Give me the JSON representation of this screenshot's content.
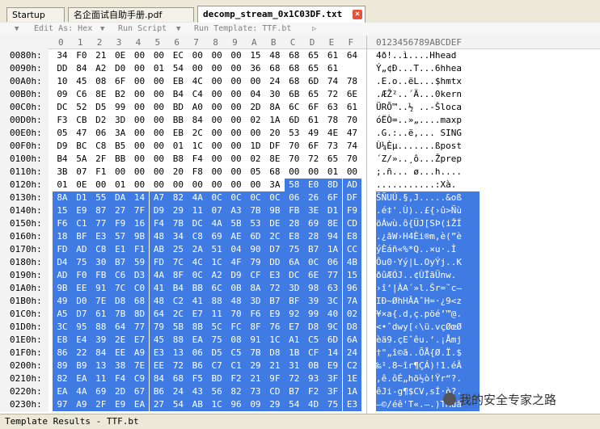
{
  "tabs": [
    {
      "label": "Startup"
    },
    {
      "label": "名企面试自助手册.pdf"
    },
    {
      "label": "decomp_stream_0x1C03DF.txt"
    }
  ],
  "toolbar": {
    "edit_as": "Edit As: Hex",
    "run_script": "Run Script",
    "run_template": "Run Template: TTF.bt"
  },
  "column_headers": [
    "0",
    "1",
    "2",
    "3",
    "4",
    "5",
    "6",
    "7",
    "8",
    "9",
    "A",
    "B",
    "C",
    "D",
    "E",
    "F"
  ],
  "ascii_header": "0123456789ABCDEF",
  "rows": [
    {
      "addr": "0080h:",
      "hex": [
        "34",
        "F0",
        "21",
        "0E",
        "00",
        "00",
        "EC",
        "00",
        "00",
        "00",
        "15",
        "48",
        "68",
        "65",
        "61",
        "64"
      ],
      "ascii": "4ð!..ì....Hhead"
    },
    {
      "addr": "0090h:",
      "hex": [
        "DD",
        "84",
        "A2",
        "D0",
        "00",
        "01",
        "54",
        "00",
        "00",
        "00",
        "36",
        "68",
        "68",
        "65",
        "61"
      ],
      "ascii": "Ý„¢Ð...T...6hhea"
    },
    {
      "addr": "00A0h:",
      "hex": [
        "10",
        "45",
        "08",
        "6F",
        "00",
        "00",
        "EB",
        "4C",
        "00",
        "00",
        "00",
        "24",
        "68",
        "6D",
        "74",
        "78"
      ],
      "ascii": ".E.o..ëL...$hmtx"
    },
    {
      "addr": "00B0h:",
      "hex": [
        "09",
        "C6",
        "8E",
        "B2",
        "00",
        "00",
        "B4",
        "C4",
        "00",
        "00",
        "04",
        "30",
        "6B",
        "65",
        "72",
        "6E"
      ],
      "ascii": ".ÆŽ²..´Ä...0kern"
    },
    {
      "addr": "00C0h:",
      "hex": [
        "DC",
        "52",
        "D5",
        "99",
        "00",
        "00",
        "BD",
        "A0",
        "00",
        "00",
        "2D",
        "8A",
        "6C",
        "6F",
        "63",
        "61"
      ],
      "ascii": "ÜRÕ™..½ ..-Šloca"
    },
    {
      "addr": "00D0h:",
      "hex": [
        "F3",
        "CB",
        "D2",
        "3D",
        "00",
        "00",
        "BB",
        "84",
        "00",
        "00",
        "02",
        "1A",
        "6D",
        "61",
        "78",
        "70"
      ],
      "ascii": "óËÒ=..»„....maxp"
    },
    {
      "addr": "00E0h:",
      "hex": [
        "05",
        "47",
        "06",
        "3A",
        "00",
        "00",
        "EB",
        "2C",
        "00",
        "00",
        "00",
        "20",
        "53",
        "49",
        "4E",
        "47"
      ],
      "ascii": ".G.:..ë,... SING"
    },
    {
      "addr": "00F0h:",
      "hex": [
        "D9",
        "BC",
        "C8",
        "B5",
        "00",
        "00",
        "01",
        "1C",
        "00",
        "00",
        "1D",
        "DF",
        "70",
        "6F",
        "73",
        "74"
      ],
      "ascii": "Ù¼Èµ.......ßpost"
    },
    {
      "addr": "0100h:",
      "hex": [
        "B4",
        "5A",
        "2F",
        "BB",
        "00",
        "00",
        "B8",
        "F4",
        "00",
        "00",
        "02",
        "8E",
        "70",
        "72",
        "65",
        "70"
      ],
      "ascii": "´Z/»..¸ô...Žprep"
    },
    {
      "addr": "0110h:",
      "hex": [
        "3B",
        "07",
        "F1",
        "00",
        "00",
        "00",
        "20",
        "F8",
        "00",
        "00",
        "05",
        "68",
        "00",
        "00",
        "01",
        "00"
      ],
      "ascii": ";.ñ... ø...h...."
    },
    {
      "addr": "0120h:",
      "hex": [
        "01",
        "0E",
        "00",
        "01",
        "00",
        "00",
        "00",
        "00",
        "00",
        "00",
        "00",
        "3A",
        "58",
        "E0",
        "8D",
        "AD"
      ],
      "ascii": "...........:Xà.­"
    },
    {
      "addr": "0130h:",
      "hex": [
        "8A",
        "D1",
        "55",
        "DA",
        "14",
        "A7",
        "82",
        "4A",
        "0C",
        "0C",
        "0C",
        "0C",
        "06",
        "26",
        "6F",
        "DF"
      ],
      "ascii": "ŠÑUÚ.§‚J.....&oß"
    },
    {
      "addr": "0140h:",
      "hex": [
        "15",
        "E9",
        "87",
        "27",
        "7F",
        "D9",
        "29",
        "11",
        "07",
        "A3",
        "7B",
        "9B",
        "FB",
        "3E",
        "D1",
        "F9"
      ],
      "ascii": ".é‡'.Ù)..£{›û>Ñù"
    },
    {
      "addr": "0150h:",
      "hex": [
        "F6",
        "C1",
        "77",
        "F9",
        "16",
        "F4",
        "7B",
        "DC",
        "4A",
        "5B",
        "53",
        "DE",
        "28",
        "69",
        "8E",
        "CD"
      ],
      "ascii": "öÁwù.ô{ÜJ[SÞ(iŽÍ"
    },
    {
      "addr": "0160h:",
      "hex": [
        "18",
        "BF",
        "E3",
        "57",
        "9B",
        "48",
        "34",
        "C8",
        "69",
        "AE",
        "6D",
        "2C",
        "E8",
        "28",
        "94",
        "E8"
      ],
      "ascii": ".¿ãW›H4Èi®m,è(”è"
    },
    {
      "addr": "0170h:",
      "hex": [
        "FD",
        "AD",
        "C8",
        "E1",
        "F1",
        "AB",
        "25",
        "2A",
        "51",
        "04",
        "90",
        "D7",
        "75",
        "B7",
        "1A",
        "CC"
      ],
      "ascii": "ý­Èáñ«%*Q..×u·.Ì"
    },
    {
      "addr": "0180h:",
      "hex": [
        "D4",
        "75",
        "30",
        "B7",
        "59",
        "FD",
        "7C",
        "4C",
        "1C",
        "4F",
        "79",
        "DD",
        "6A",
        "0C",
        "06",
        "4B"
      ],
      "ascii": "Ôu0·Yý|L.OyÝj..K"
    },
    {
      "addr": "0190h:",
      "hex": [
        "AD",
        "F0",
        "FB",
        "C6",
        "D3",
        "4A",
        "8F",
        "0C",
        "A2",
        "D9",
        "CF",
        "E3",
        "DC",
        "6E",
        "77",
        "15"
      ],
      "ascii": "­ðûÆÓJ..¢ÙÏãÜnw."
    },
    {
      "addr": "01A0h:",
      "hex": [
        "9B",
        "EE",
        "91",
        "7C",
        "C0",
        "41",
        "B4",
        "BB",
        "6C",
        "0B",
        "8A",
        "72",
        "3D",
        "98",
        "63",
        "96"
      ],
      "ascii": "›î‘|ÀA´»l.Šr=˜c–"
    },
    {
      "addr": "01B0h:",
      "hex": [
        "49",
        "D0",
        "7E",
        "D8",
        "68",
        "48",
        "C2",
        "41",
        "88",
        "48",
        "3D",
        "B7",
        "BF",
        "39",
        "3C",
        "7A"
      ],
      "ascii": "IÐ~ØhHÂAˆH=·¿9<z"
    },
    {
      "addr": "01C0h:",
      "hex": [
        "A5",
        "D7",
        "61",
        "7B",
        "8D",
        "64",
        "2C",
        "E7",
        "11",
        "70",
        "F6",
        "E9",
        "92",
        "99",
        "40",
        "02"
      ],
      "ascii": "¥×a{.d,ç.pöé’™@."
    },
    {
      "addr": "01D0h:",
      "hex": [
        "3C",
        "95",
        "88",
        "64",
        "77",
        "79",
        "5B",
        "8B",
        "5C",
        "FC",
        "8F",
        "76",
        "E7",
        "D8",
        "9C",
        "D8"
      ],
      "ascii": "<•ˆdwy[‹\\ü.vçØœØ"
    },
    {
      "addr": "01E0h:",
      "hex": [
        "E8",
        "E4",
        "39",
        "2E",
        "E7",
        "45",
        "88",
        "EA",
        "75",
        "08",
        "91",
        "1C",
        "A1",
        "C5",
        "6D",
        "6A"
      ],
      "ascii": "èä9.çEˆêu.‘.¡Åmj"
    },
    {
      "addr": "01F0h:",
      "hex": [
        "86",
        "22",
        "84",
        "EE",
        "A9",
        "E3",
        "13",
        "06",
        "D5",
        "C5",
        "7B",
        "D8",
        "1B",
        "CF",
        "14",
        "24"
      ],
      "ascii": "†\"„î©ã..ÕÅ{Ø.Ï.$"
    },
    {
      "addr": "0200h:",
      "hex": [
        "89",
        "B9",
        "13",
        "38",
        "7E",
        "EE",
        "72",
        "B6",
        "C7",
        "C1",
        "29",
        "21",
        "31",
        "0B",
        "E9",
        "C2"
      ],
      "ascii": "‰¹.8~îr¶ÇÁ)!1.éÂ"
    },
    {
      "addr": "0210h:",
      "hex": [
        "82",
        "EA",
        "11",
        "F4",
        "C9",
        "84",
        "68",
        "F5",
        "BD",
        "F2",
        "21",
        "9F",
        "72",
        "93",
        "3F",
        "1E"
      ],
      "ascii": "‚ê.ôÉ„hõ½ò!Ÿr“?."
    },
    {
      "addr": "0220h:",
      "hex": [
        "EA",
        "4A",
        "69",
        "2D",
        "67",
        "B6",
        "24",
        "43",
        "56",
        "82",
        "73",
        "CD",
        "B7",
        "F2",
        "3F",
        "1A"
      ],
      "ascii": "êJi-g¶$CV‚sÍ·ò?."
    },
    {
      "addr": "0230h:",
      "hex": [
        "97",
        "A9",
        "2F",
        "E9",
        "EA",
        "27",
        "54",
        "AB",
        "1C",
        "96",
        "09",
        "29",
        "54",
        "4D",
        "75",
        "E3"
      ],
      "ascii": "—©/éê'T«.–.)TMuã"
    }
  ],
  "status": {
    "label": "Template Results - TTF.bt"
  },
  "watermark": {
    "text": "我的安全专家之路"
  },
  "colors": {
    "selection": "#3f7be2",
    "selection_text": "#ffffff",
    "active_tab_close": "#e2553b"
  }
}
